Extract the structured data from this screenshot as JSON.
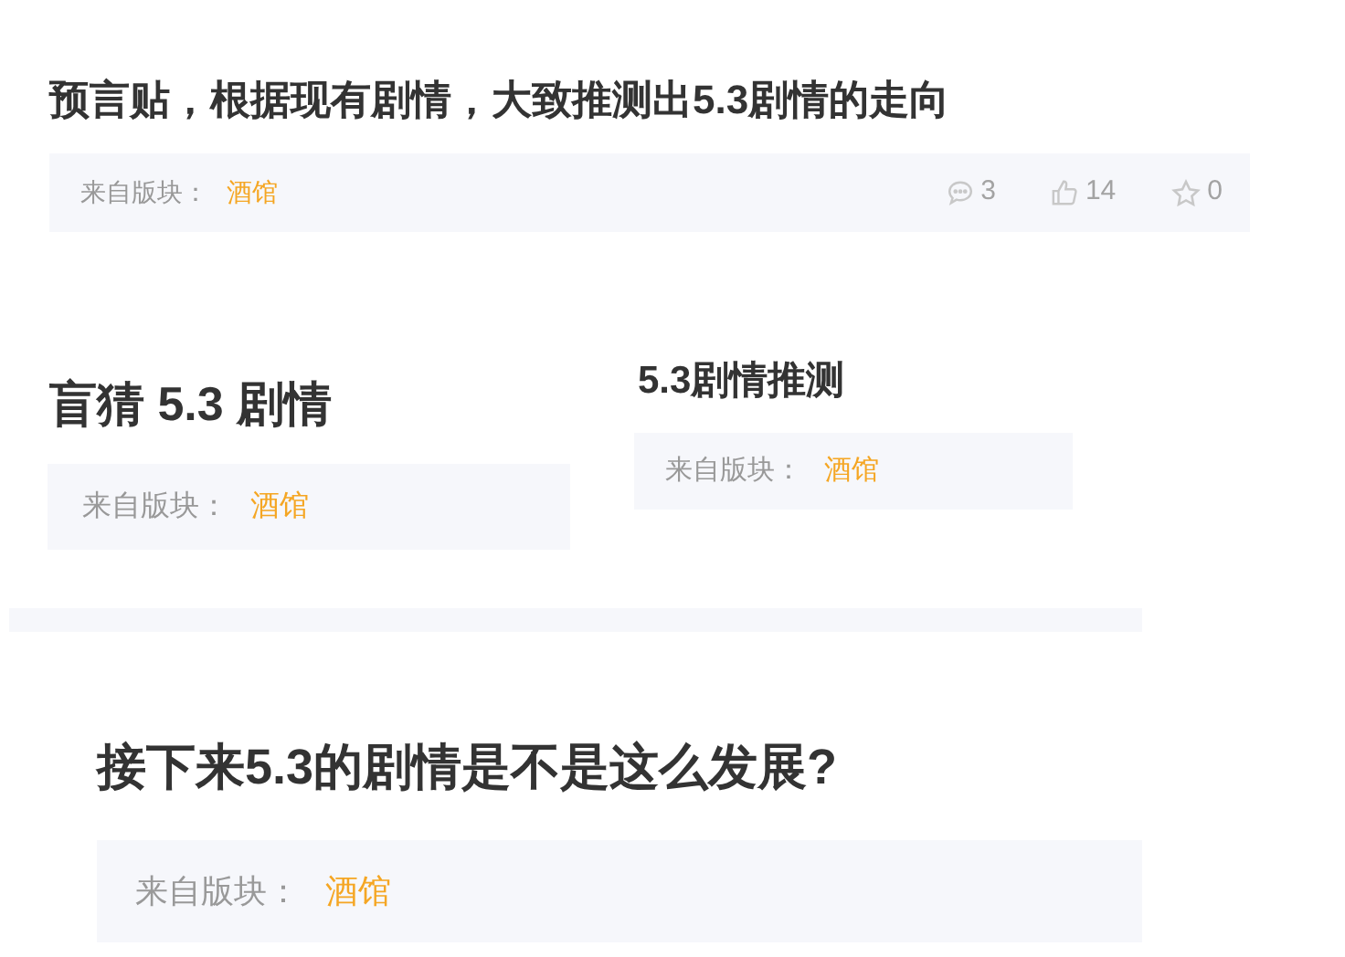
{
  "cards": [
    {
      "title": "预言贴，根据现有剧情，大致推测出5.3剧情的走向",
      "forum_label": "来自版块：",
      "forum": "酒馆",
      "stats": [
        {
          "kind": "comment",
          "count": "3"
        },
        {
          "kind": "like",
          "count": "14"
        },
        {
          "kind": "favorite",
          "count": "0"
        }
      ]
    },
    {
      "title": "盲猜 5.3 剧情",
      "forum_label": "来自版块：",
      "forum": "酒馆"
    },
    {
      "title": "5.3剧情推测",
      "forum_label": "来自版块：",
      "forum": "酒馆"
    },
    {
      "title": "接下来5.3的剧情是不是这么发展?",
      "forum_label": "来自版块：",
      "forum": "酒馆"
    }
  ]
}
